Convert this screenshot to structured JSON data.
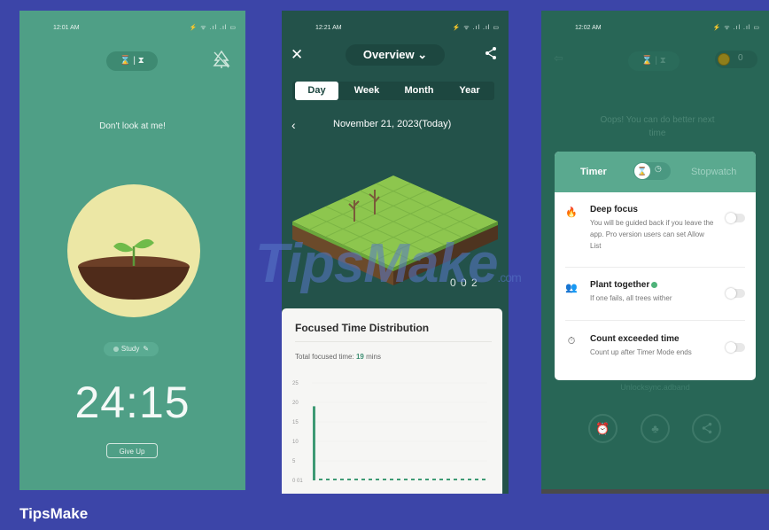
{
  "brand": "TipsMake",
  "watermark": {
    "text": "TipsMake",
    "suffix": ".com"
  },
  "panel1": {
    "time": "12:01 AM",
    "status_icons": "⚡ ᯤ .ıl .ıl ▭",
    "mode": "⌛ | ⧗",
    "message": "Don't look at me!",
    "tag_label": "Study",
    "timer": "24:15",
    "give_up": "Give Up"
  },
  "panel2": {
    "time": "12:21 AM",
    "status_icons": "⚡ ᯤ .ıl .ıl ▭",
    "close": "✕",
    "title": "Overview ⌄",
    "tabs": [
      {
        "label": "Day"
      },
      {
        "label": "Week"
      },
      {
        "label": "Month"
      },
      {
        "label": "Year"
      }
    ],
    "date": "November 21, 2023(Today)",
    "counts": "0 0 2",
    "card_title": "Focused Time Distribution",
    "total_label": "Total focused time:",
    "total_value": "19",
    "total_unit": "mins"
  },
  "panel3": {
    "time": "12:02 AM",
    "status_icons": "⚡ ᯤ .ıl .ıl ▭",
    "mode": "⌛ | ⧗",
    "coins": "0",
    "message": "Oops! You can do better next time",
    "timer_label": "Timer",
    "stopwatch_label": "Stopwatch",
    "options": [
      {
        "title": "Deep focus",
        "desc": "You will be guided back if you leave the app. Pro version users can set Allow List",
        "icon": "flame-icon"
      },
      {
        "title": "Plant together",
        "desc": "If one fails, all trees wither",
        "icon": "people-icon"
      },
      {
        "title": "Count exceeded time",
        "desc": "Count up after Timer Mode ends",
        "icon": "stopwatch-icon"
      }
    ],
    "hashtag": "Unlocksync.adband"
  },
  "chart_data": {
    "type": "bar",
    "title": "Focused Time Distribution",
    "yticks": [
      "25",
      "20",
      "15",
      "10",
      "5",
      "0 01"
    ],
    "ylim": [
      0,
      25
    ],
    "values": [
      19
    ],
    "accent": "#3e9a74"
  }
}
